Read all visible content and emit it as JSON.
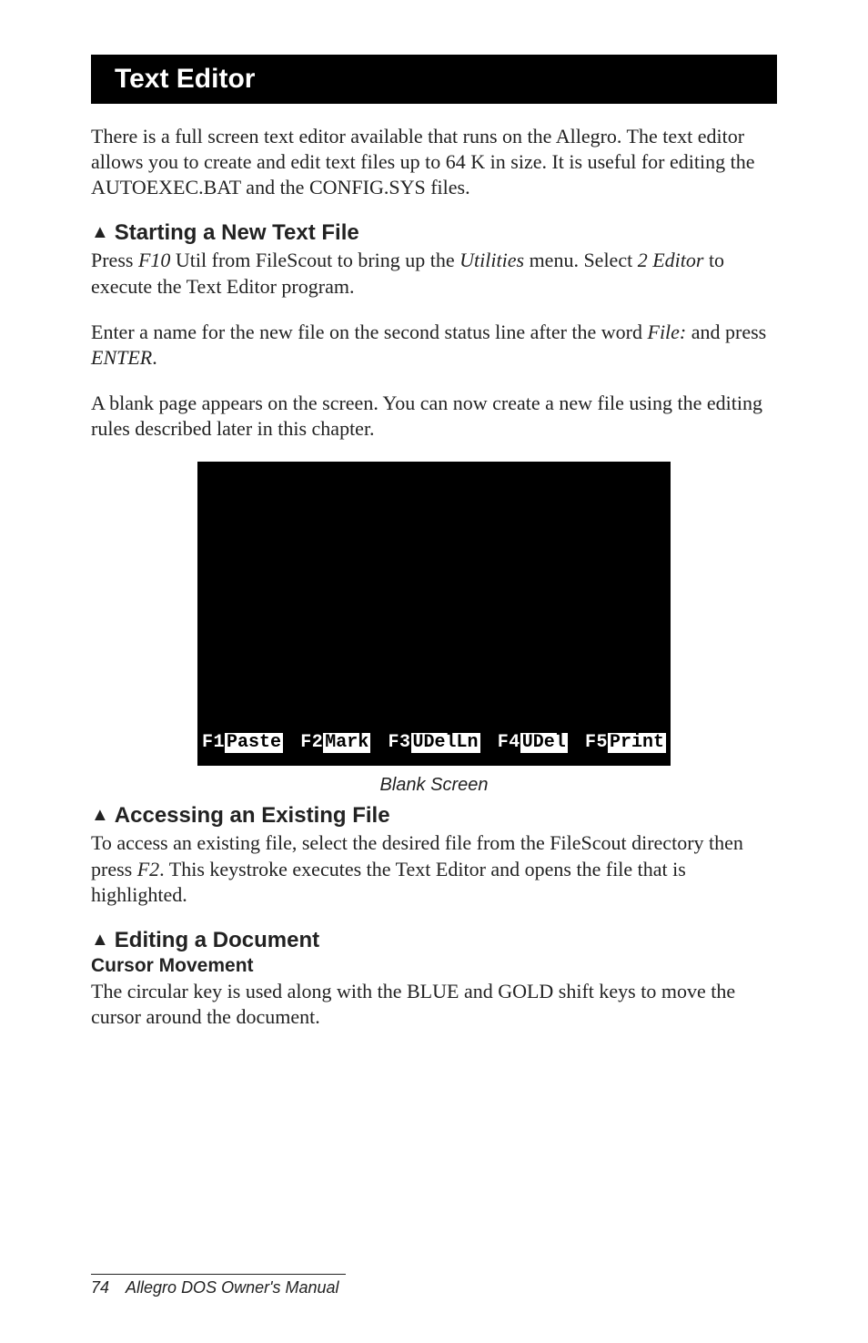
{
  "header": {
    "title": "Text Editor"
  },
  "intro": "There is a full screen text editor available that runs on the Allegro. The text editor allows you to create and edit text files up to 64 K in size. It is useful for editing the AUTOEXEC.BAT and the CONFIG.SYS files.",
  "sections": {
    "starting": {
      "heading": "Starting a New Text File",
      "p1_a": "Press ",
      "p1_f10": "F10",
      "p1_b": " Util from FileScout to bring up the ",
      "p1_util": "Utilities",
      "p1_c": " menu. Select ",
      "p1_2editor": "2 Editor",
      "p1_d": " to execute the Text Editor program.",
      "p2_a": "Enter a name for the new file on the second status line after the word ",
      "p2_file": "File:",
      "p2_b": " and press ",
      "p2_enter": "ENTER",
      "p2_c": ".",
      "p3": "A blank page appears on the screen. You can now create a new file using the editing rules described later in this chapter."
    },
    "figure": {
      "f1": "F1",
      "f1v": "Paste",
      "f2": "F2",
      "f2v": "Mark",
      "f3": "F3",
      "f3v": "UDelLn",
      "f4": "F4",
      "f4v": "UDel",
      "f5": "F5",
      "f5v": "Print",
      "caption": "Blank Screen"
    },
    "accessing": {
      "heading": "Accessing an Existing File",
      "p_a": "To access an existing file, select the desired file from the FileScout directory then press ",
      "p_f2": "F2",
      "p_b": ". This keystroke executes the Text Editor and opens the file that is highlighted."
    },
    "editing": {
      "heading": "Editing a Document",
      "sub": "Cursor Movement",
      "p": "The circular key is used along with the BLUE and GOLD shift keys to move the cursor around the document."
    }
  },
  "footer": {
    "page": "74",
    "title": "Allegro DOS Owner's Manual"
  }
}
